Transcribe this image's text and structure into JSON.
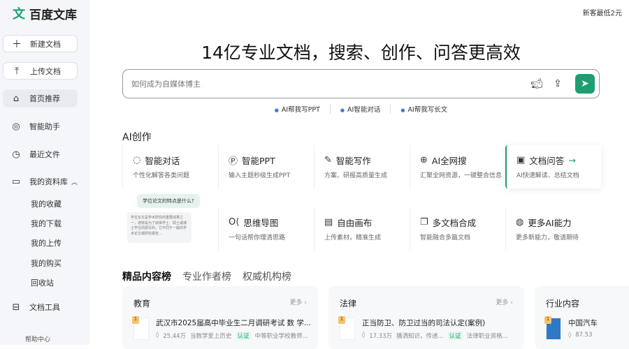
{
  "brand": {
    "logo_mark": "文",
    "name": "百度文库"
  },
  "promo": "新客最低2元",
  "sidebar": {
    "new_doc": "新建文档",
    "upload_doc": "上传文档",
    "nav": [
      {
        "label": "首页推荐"
      },
      {
        "label": "智能助手"
      },
      {
        "label": "最近文件"
      },
      {
        "label": "我的资料库"
      }
    ],
    "library_items": [
      "我的收藏",
      "我的下载",
      "我的上传",
      "我的购买",
      "回收站"
    ],
    "tools": "文档工具",
    "help": "帮助中心"
  },
  "hero": {
    "title": "14亿专业文档，搜索、创作、问答更高效",
    "search_placeholder": "如何成为自媒体博主",
    "quick_links": [
      "AI帮我写PPT",
      "AI智能对话",
      "AI帮我写长文"
    ]
  },
  "ai": {
    "heading": "AI创作",
    "cards": [
      {
        "title": "智能对话",
        "sub": "个性化解答各类问题",
        "icon": "chat-icon"
      },
      {
        "title": "智能PPT",
        "sub": "输入主题秒级生成PPT",
        "icon": "ppt-icon"
      },
      {
        "title": "智能写作",
        "sub": "方案、研报高质量生成",
        "icon": "pen-icon"
      },
      {
        "title": "AI全网搜",
        "sub": "汇聚全网资源，一键整合信息",
        "icon": "search-icon"
      },
      {
        "title": "文档问答",
        "sub": "AI快速解读、总结文档",
        "icon": "doc-qa-icon"
      },
      {
        "title": "思维导图",
        "sub": "一句话帮你理清思路",
        "icon": "mindmap-icon"
      },
      {
        "title": "自由画布",
        "sub": "上传素材，精准生成",
        "icon": "canvas-icon"
      },
      {
        "title": "多文档合成",
        "sub": "智能融合多篇文档",
        "icon": "multi-doc-icon"
      },
      {
        "title": "更多AI能力",
        "sub": "更多新能力，敬请期待",
        "icon": "more-ai-icon"
      }
    ],
    "illustration": {
      "question": "学位论文的特点是什么?",
      "answer": "学位论文是学术研究的重要成果之一，通常是为了获得学士、硕士或博士学位而撰写的，它不同于一般的学术论文或研究报告..."
    }
  },
  "rank": {
    "tabs": [
      "精品内容榜",
      "专业作者榜",
      "权威机构榜"
    ],
    "panels": [
      {
        "title": "教育",
        "more": "更多 ›",
        "item": {
          "rank": "1",
          "title": "武汉市2025届高中毕业生二月调研考试 数 学...",
          "views": "25.44万",
          "author": "当数学爱上历史",
          "badge": "认证",
          "org": "中等职业学校教师..."
        }
      },
      {
        "title": "法律",
        "more": "更多 ›",
        "item": {
          "rank": "1",
          "title": "正当防卫、防卫过当的司法认定(案例)",
          "views": "17.33万",
          "author": "播洒知识，传递...",
          "badge": "认证",
          "org": "法律职业资格..."
        }
      },
      {
        "title": "行业内容",
        "item": {
          "rank": "1",
          "title": "中国汽车",
          "views": "87.53"
        }
      }
    ]
  }
}
